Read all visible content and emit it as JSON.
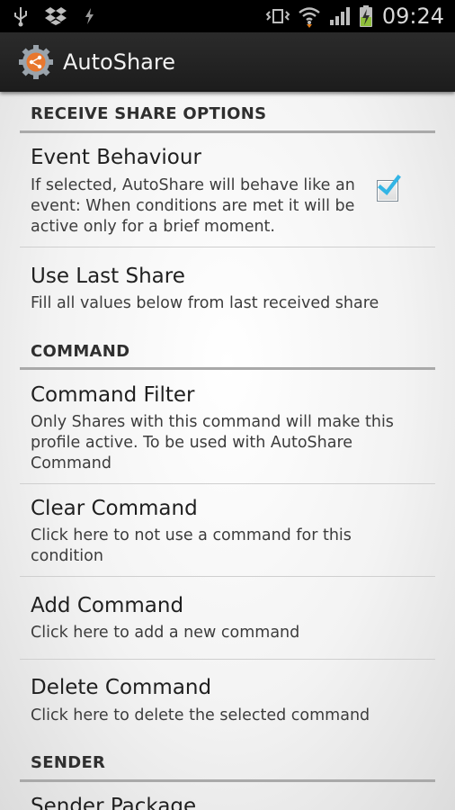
{
  "status_bar": {
    "time": "09:24",
    "left_icons": [
      "usb-icon",
      "dropbox-icon",
      "tasker-bolt-icon"
    ],
    "right_icons": [
      "vibrate-icon",
      "wifi-icon",
      "signal-icon",
      "battery-charging-icon"
    ]
  },
  "action_bar": {
    "title": "AutoShare",
    "icon": "autoshare-gear-icon"
  },
  "sections": {
    "receive": {
      "title": "RECEIVE SHARE OPTIONS"
    },
    "command": {
      "title": "COMMAND"
    },
    "sender": {
      "title": "SENDER"
    }
  },
  "prefs": {
    "event_behaviour": {
      "title": "Event Behaviour",
      "summary": "If selected, AutoShare will behave like an event: When conditions are met it will be active only for a brief moment.",
      "checked": true
    },
    "use_last_share": {
      "title": "Use Last Share",
      "summary": "Fill all values below from last received share"
    },
    "command_filter": {
      "title": "Command Filter",
      "summary": "Only Shares with this command will make this profile active. To be used with AutoShare Command"
    },
    "clear_command": {
      "title": "Clear Command",
      "summary": "Click here to not use a command for this condition"
    },
    "add_command": {
      "title": "Add Command",
      "summary": "Click here to add a new command"
    },
    "delete_command": {
      "title": "Delete Command",
      "summary": "Click here to delete the selected command"
    },
    "sender_package": {
      "title": "Sender Package"
    }
  },
  "colors": {
    "checkbox_check": "#33b5e5",
    "section_line": "#a9a9a9",
    "action_bar": "#222222"
  }
}
